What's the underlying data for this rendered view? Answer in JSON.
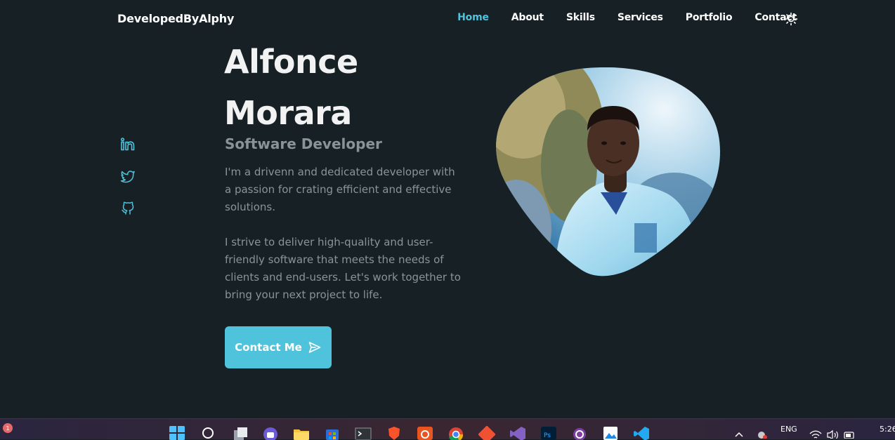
{
  "header": {
    "brand": "DevelopedByAlphy",
    "nav": [
      {
        "label": "Home",
        "active": true
      },
      {
        "label": "About",
        "active": false
      },
      {
        "label": "Skills",
        "active": false
      },
      {
        "label": "Services",
        "active": false
      },
      {
        "label": "Portfolio",
        "active": false
      },
      {
        "label": "Contact",
        "active": false
      }
    ],
    "theme_toggle_icon": "sun-icon"
  },
  "social": [
    {
      "icon": "linkedin-icon"
    },
    {
      "icon": "twitter-icon"
    },
    {
      "icon": "github-icon"
    }
  ],
  "hero": {
    "name_line1": "Alfonce",
    "name_line2": "Morara",
    "role": "Software Developer",
    "paragraph1": "I'm a drivenn and dedicated developer with a passion for crating efficient and effective solutions.",
    "paragraph2": "I strive to deliver high-quality and user-friendly software that meets the needs of clients and end-users. Let's work together to bring your next project to life.",
    "cta_label": "Contact Me",
    "cta_icon": "send-icon"
  },
  "colors": {
    "background": "#172125",
    "accent": "#4fc3dc",
    "text_primary": "#f2f2f2",
    "text_muted": "#8a9498"
  },
  "taskbar": {
    "notification_count": "1",
    "language_line1": "ENG",
    "clock": "5:26"
  }
}
